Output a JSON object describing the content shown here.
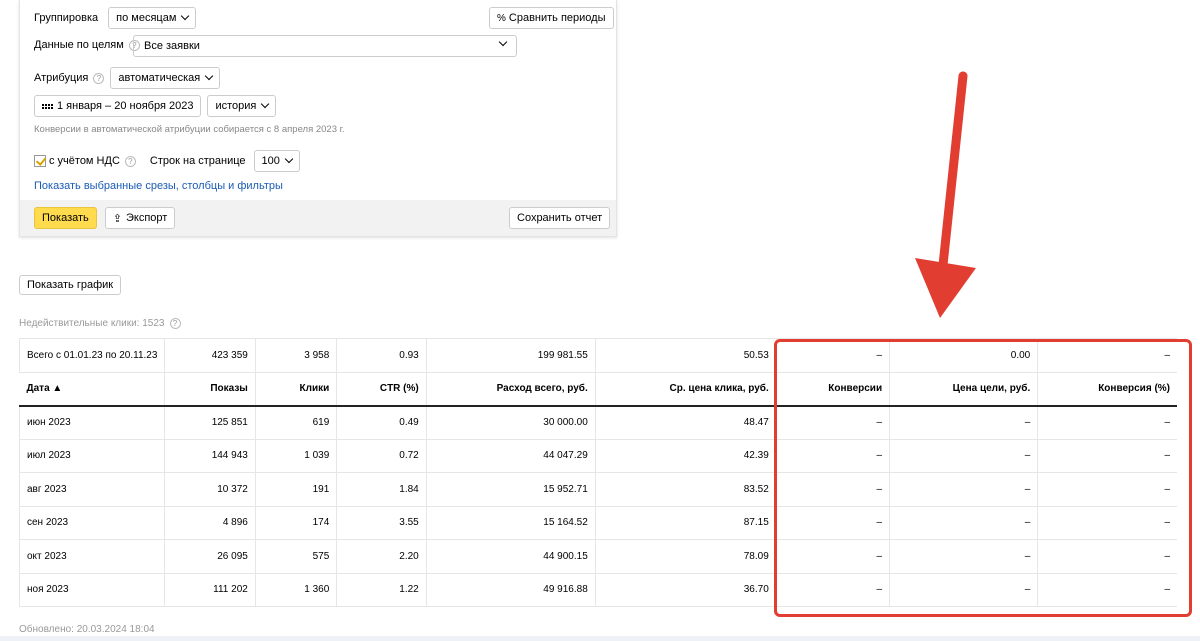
{
  "filters": {
    "grouping_label": "Группировка",
    "grouping_value": "по месяцам",
    "compare_button": "Сравнить периоды",
    "compare_icon": "percent-icon",
    "goals_label": "Данные по целям",
    "goals_value": "Все заявки",
    "attribution_label": "Атрибуция",
    "attribution_value": "автоматическая",
    "date_range": "1 января – 20 ноября 2023",
    "history_value": "история",
    "attribution_note": "Конверсии в автоматической атрибуции собирается с 8 апреля 2023 г.",
    "vat_label": "с учётом НДС",
    "vat_checked": true,
    "rows_label": "Строк на странице",
    "rows_value": "100",
    "show_slices_link": "Показать выбранные срезы, столбцы и фильтры",
    "show_button": "Показать",
    "export_button": "Экспорт",
    "save_button": "Сохранить отчет"
  },
  "graph_button": "Показать график",
  "invalid_clicks": "Недействительные клики: 1523",
  "table": {
    "total": [
      "Всего с 01.01.23 по 20.11.23",
      "423 359",
      "3 958",
      "0.93",
      "199 981.55",
      "50.53",
      "–",
      "0.00",
      "–"
    ],
    "headers": [
      "Дата ▲",
      "Показы",
      "Клики",
      "CTR (%)",
      "Расход всего, руб.",
      "Ср. цена клика, руб.",
      "Конверсии",
      "Цена цели, руб.",
      "Конверсия (%)"
    ],
    "rows": [
      [
        "июн 2023",
        "125 851",
        "619",
        "0.49",
        "30 000.00",
        "48.47",
        "–",
        "–",
        "–"
      ],
      [
        "июл 2023",
        "144 943",
        "1 039",
        "0.72",
        "44 047.29",
        "42.39",
        "–",
        "–",
        "–"
      ],
      [
        "авг 2023",
        "10 372",
        "191",
        "1.84",
        "15 952.71",
        "83.52",
        "–",
        "–",
        "–"
      ],
      [
        "сен 2023",
        "4 896",
        "174",
        "3.55",
        "15 164.52",
        "87.15",
        "–",
        "–",
        "–"
      ],
      [
        "окт 2023",
        "26 095",
        "575",
        "2.20",
        "44 900.15",
        "78.09",
        "–",
        "–",
        "–"
      ],
      [
        "ноя 2023",
        "111 202",
        "1 360",
        "1.22",
        "49 916.88",
        "36.70",
        "–",
        "–",
        "–"
      ]
    ]
  },
  "updated": "Обновлено: 20.03.2024 18:04",
  "colors": {
    "accent_yellow": "#ffdb4d",
    "annotation_red": "#e23d31",
    "link_blue": "#1a5bb5"
  }
}
